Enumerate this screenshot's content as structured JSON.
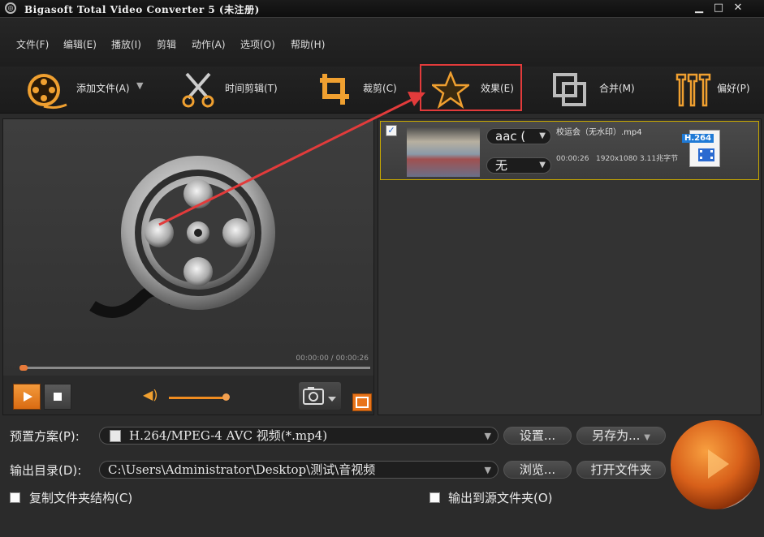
{
  "window": {
    "title": "Bigasoft Total Video Converter 5 (未注册)",
    "min_icon": "minimize-icon",
    "max_icon": "maximize-icon",
    "close_icon": "close-icon"
  },
  "menu": [
    "文件(F)",
    "编辑(E)",
    "播放(I)",
    "剪辑",
    "动作(A)",
    "选项(O)",
    "帮助(H)"
  ],
  "toolbar": {
    "add_file": "添加文件(A)",
    "trim": "时间剪辑(T)",
    "crop": "裁剪(C)",
    "effect": "效果(E)",
    "merge": "合并(M)",
    "prefs": "偏好(P)"
  },
  "preview": {
    "time": "00:00:00 / 00:00:26"
  },
  "file": {
    "name": "校运会（无水印）.mp4",
    "audio": "aac (",
    "subtitle": "无",
    "duration": "00:00:26",
    "resolution": "1920x1080",
    "size": "3.11兆字节",
    "format_badge": "H.264"
  },
  "bottom": {
    "preset_label": "预置方案(P):",
    "preset_value": "H.264/MPEG-4 AVC 视频(*.mp4)",
    "settings_btn": "设置...",
    "save_as_btn": "另存为...",
    "output_label": "输出目录(D):",
    "output_value": "C:\\Users\\Administrator\\Desktop\\测试\\音视频",
    "browse_btn": "浏览...",
    "open_folder_btn": "打开文件夹",
    "copy_structure": "复制文件夹结构(C)",
    "output_to_source": "输出到源文件夹(O)"
  },
  "colors": {
    "accent": "#e8741a",
    "highlight": "#e23b3b",
    "selection": "#c8a800"
  }
}
